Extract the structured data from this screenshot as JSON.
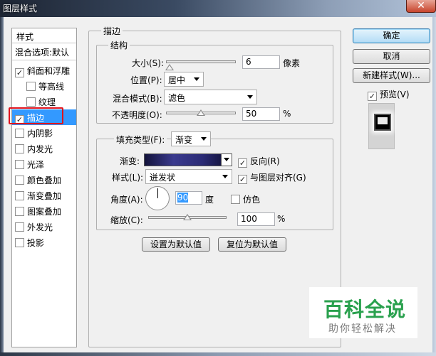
{
  "window": {
    "title": "图层样式",
    "close_label": "✕"
  },
  "sidebar": {
    "header": "样式",
    "blend_label": "混合选项:默认",
    "items": [
      {
        "label": "斜面和浮雕",
        "checked": "✓"
      },
      {
        "label": "等高线",
        "checked": ""
      },
      {
        "label": "纹理",
        "checked": ""
      },
      {
        "label": "描边",
        "checked": "✓"
      },
      {
        "label": "内阴影",
        "checked": ""
      },
      {
        "label": "内发光",
        "checked": ""
      },
      {
        "label": "光泽",
        "checked": ""
      },
      {
        "label": "颜色叠加",
        "checked": ""
      },
      {
        "label": "渐变叠加",
        "checked": ""
      },
      {
        "label": "图案叠加",
        "checked": ""
      },
      {
        "label": "外发光",
        "checked": ""
      },
      {
        "label": "投影",
        "checked": ""
      }
    ]
  },
  "stroke": {
    "group_title": "描边",
    "structure_title": "结构",
    "size_label": "大小(S):",
    "size_value": "6",
    "size_unit": "像素",
    "position_label": "位置(P):",
    "position_value": "居中",
    "blend_label": "混合模式(B):",
    "blend_value": "滤色",
    "opacity_label": "不透明度(O):",
    "opacity_value": "50",
    "opacity_unit": "%",
    "size_slider_fraction": 0.05,
    "opacity_slider_fraction": 0.5
  },
  "fill": {
    "type_label": "填充类型(F):",
    "type_value": "渐变",
    "gradient_label": "渐变:",
    "reverse_label": "反向(R)",
    "reverse_checked": "✓",
    "style_label": "样式(L):",
    "style_value": "迸发状",
    "align_label": "与图层对齐(G)",
    "align_checked": "✓",
    "angle_label": "角度(A):",
    "angle_value": "90",
    "angle_unit": "度",
    "dither_label": "仿色",
    "dither_checked": "",
    "scale_label": "缩放(C):",
    "scale_value": "100",
    "scale_unit": "%",
    "scale_slider_fraction": 0.5
  },
  "buttons": {
    "ok": "确定",
    "cancel": "取消",
    "new_style": "新建样式(W)...",
    "preview_label": "预览(V)",
    "preview_checked": "✓",
    "set_default": "设置为默认值",
    "reset_default": "复位为默认值"
  },
  "watermark": {
    "main": "百科全说",
    "sub": "助你轻松解决"
  }
}
